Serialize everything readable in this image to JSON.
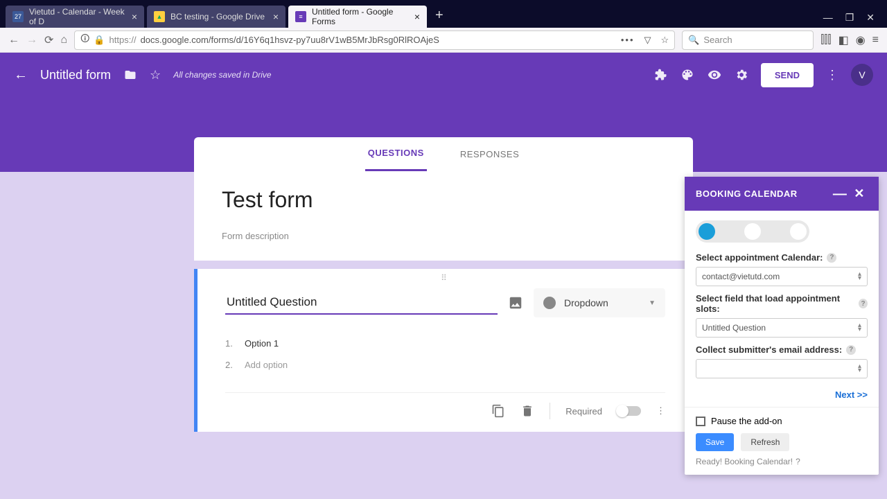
{
  "browser": {
    "tabs": [
      {
        "label": "Vietutd - Calendar - Week of D",
        "favicon_bg": "#3b5998",
        "favicon_text": "27"
      },
      {
        "label": "BC testing - Google Drive",
        "favicon_bg": "#0da960",
        "favicon_text": "▲"
      },
      {
        "label": "Untitled form - Google Forms",
        "favicon_bg": "#673ab7",
        "favicon_text": "≡",
        "active": true
      }
    ],
    "url_prefix": "https://",
    "url_rest": "docs.google.com/forms/d/16Y6q1hsvz-py7uu8rV1wB5MrJbRsg0RlROAjeS",
    "search_placeholder": "Search"
  },
  "app": {
    "doc_title": "Untitled form",
    "save_status": "All changes saved in Drive",
    "send_label": "SEND",
    "avatar_letter": "V"
  },
  "form": {
    "tabs": {
      "questions": "QUESTIONS",
      "responses": "RESPONSES"
    },
    "title": "Test form",
    "description_placeholder": "Form description",
    "question": {
      "title": "Untitled Question",
      "type": "Dropdown",
      "options": [
        {
          "n": "1.",
          "label": "Option 1"
        }
      ],
      "add_option_n": "2.",
      "add_option_label": "Add option",
      "required_label": "Required"
    }
  },
  "panel": {
    "title": "BOOKING CALENDAR",
    "label_calendar": "Select appointment Calendar:",
    "value_calendar": "contact@vietutd.com",
    "label_field": "Select field that load appointment slots:",
    "value_field": "Untitled Question",
    "label_email": "Collect submitter's email address:",
    "value_email": "",
    "next": "Next >>",
    "pause": "Pause the add-on",
    "save": "Save",
    "refresh": "Refresh",
    "status": "Ready! Booking Calendar!"
  }
}
